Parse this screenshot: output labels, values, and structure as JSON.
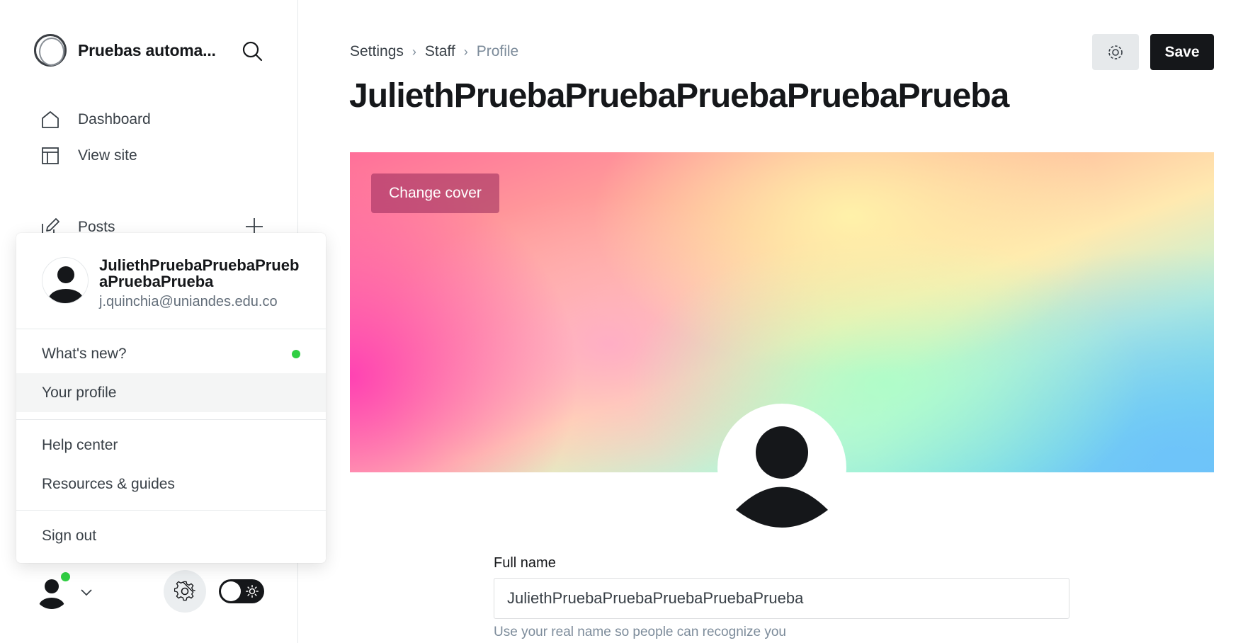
{
  "sidebar": {
    "site_title": "Pruebas automa...",
    "nav": {
      "dashboard": "Dashboard",
      "view_site": "View site",
      "posts": "Posts"
    }
  },
  "user_menu": {
    "name": "JuliethPruebaPruebaPruebaPruebaPrueba",
    "email": "j.quinchia@uniandes.edu.co",
    "items": {
      "whats_new": "What's new?",
      "your_profile": "Your profile",
      "help_center": "Help center",
      "resources": "Resources & guides",
      "sign_out": "Sign out"
    },
    "whats_new_indicator_color": "#30cf43"
  },
  "breadcrumb": {
    "settings": "Settings",
    "staff": "Staff",
    "profile": "Profile"
  },
  "page": {
    "title": "JuliethPruebaPruebaPruebaPruebaPrueba",
    "save_label": "Save",
    "change_cover_label": "Change cover"
  },
  "form": {
    "full_name_label": "Full name",
    "full_name_value": "JuliethPruebaPruebaPruebaPruebaPrueba",
    "full_name_hint": "Use your real name so people can recognize you"
  },
  "colors": {
    "primary_button": "#15171a",
    "online_status": "#30cf43"
  },
  "icons": {
    "search": "search-icon",
    "home": "home-icon",
    "layout": "layout-icon",
    "posts": "pen-icon",
    "plus": "plus-icon",
    "gear": "gear-icon",
    "chevron": "chevron-down-icon",
    "sun": "sun-icon"
  }
}
